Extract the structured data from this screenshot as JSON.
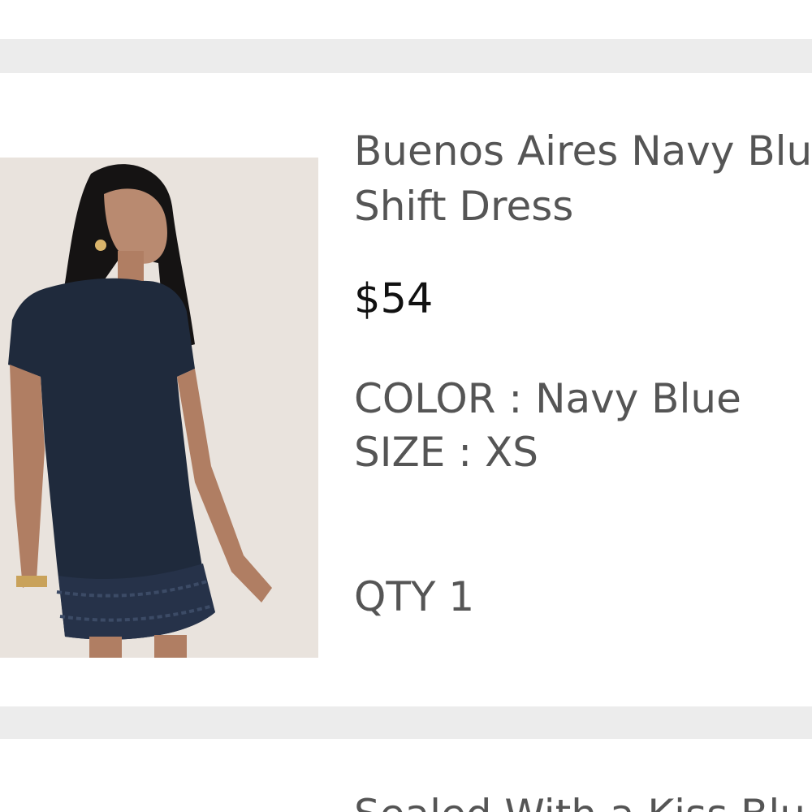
{
  "cart_item": {
    "title_line1": "Buenos Aires Navy Blu",
    "title_line2": "Shift Dress",
    "price": "$54",
    "color_label": "COLOR : Navy Blue",
    "size_label": "SIZE : XS",
    "qty_label": "QTY 1",
    "image": "navy-blue-shift-dress-photo"
  },
  "next_item": {
    "title_partial": "Sealed With a Kiss Blu"
  },
  "colors": {
    "band": "#ececec",
    "text": "#555555",
    "price": "#111111",
    "dress": "#1f2a3c"
  }
}
